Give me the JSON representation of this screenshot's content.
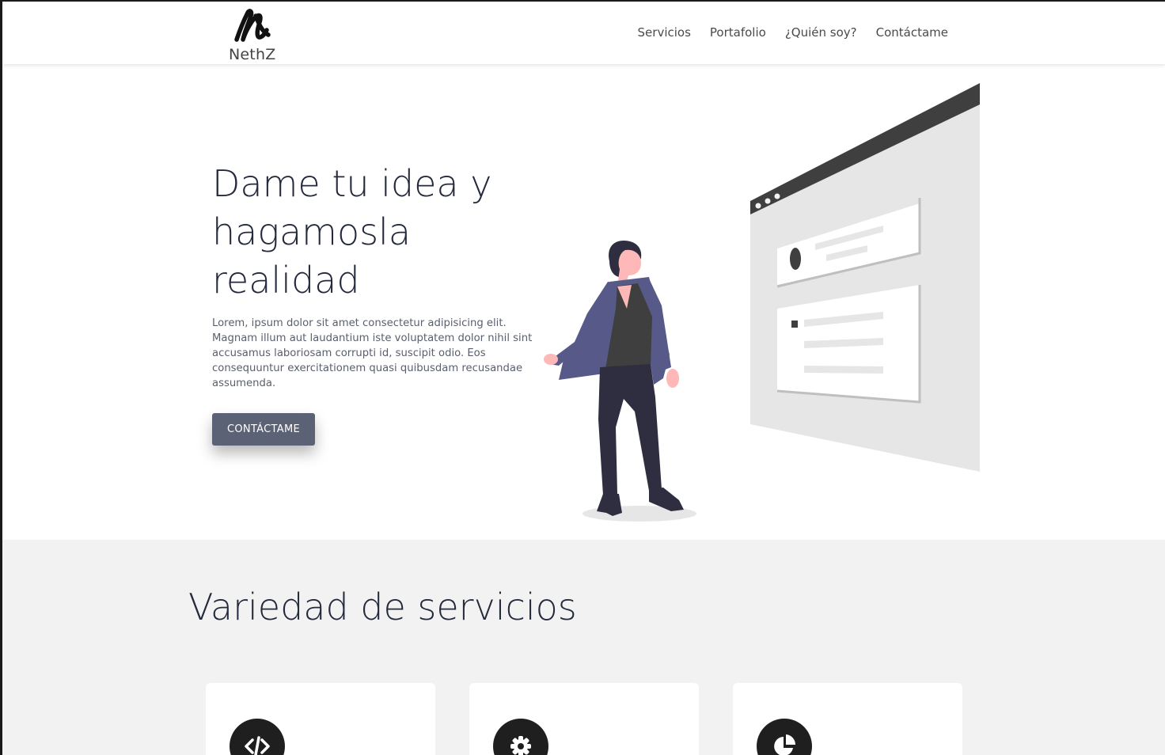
{
  "brand": {
    "logo_letter_icon": "handwritten-n-icon",
    "name": "NethZ"
  },
  "nav": {
    "items": [
      {
        "label": "Servicios"
      },
      {
        "label": "Portafolio"
      },
      {
        "label": "¿Quién soy?"
      },
      {
        "label": "Contáctame"
      }
    ]
  },
  "hero": {
    "title": "Dame tu idea y hagamosla realidad",
    "text": "Lorem, ipsum dolor sit amet consectetur adipisicing elit. Magnam illum aut laudantium iste voluptatem dolor nihil sint accusamus laboriosam corrupti id, suscipit odio. Eos consequuntur exercitationem quasi quibusdam recusandae assumenda.",
    "cta_label": "CONTÁCTAME",
    "illustration": "woman-with-browser-window-illustration"
  },
  "services": {
    "title": "Variedad de servicios",
    "cards": [
      {
        "icon": "code-icon"
      },
      {
        "icon": "gear-icon"
      },
      {
        "icon": "pie-chart-icon"
      }
    ]
  },
  "colors": {
    "primary_text": "#24293b",
    "button": "#5c6275",
    "blazer": "#575a89",
    "section_bg": "#f2f2f2",
    "icon_bg": "#1f1f1f"
  }
}
